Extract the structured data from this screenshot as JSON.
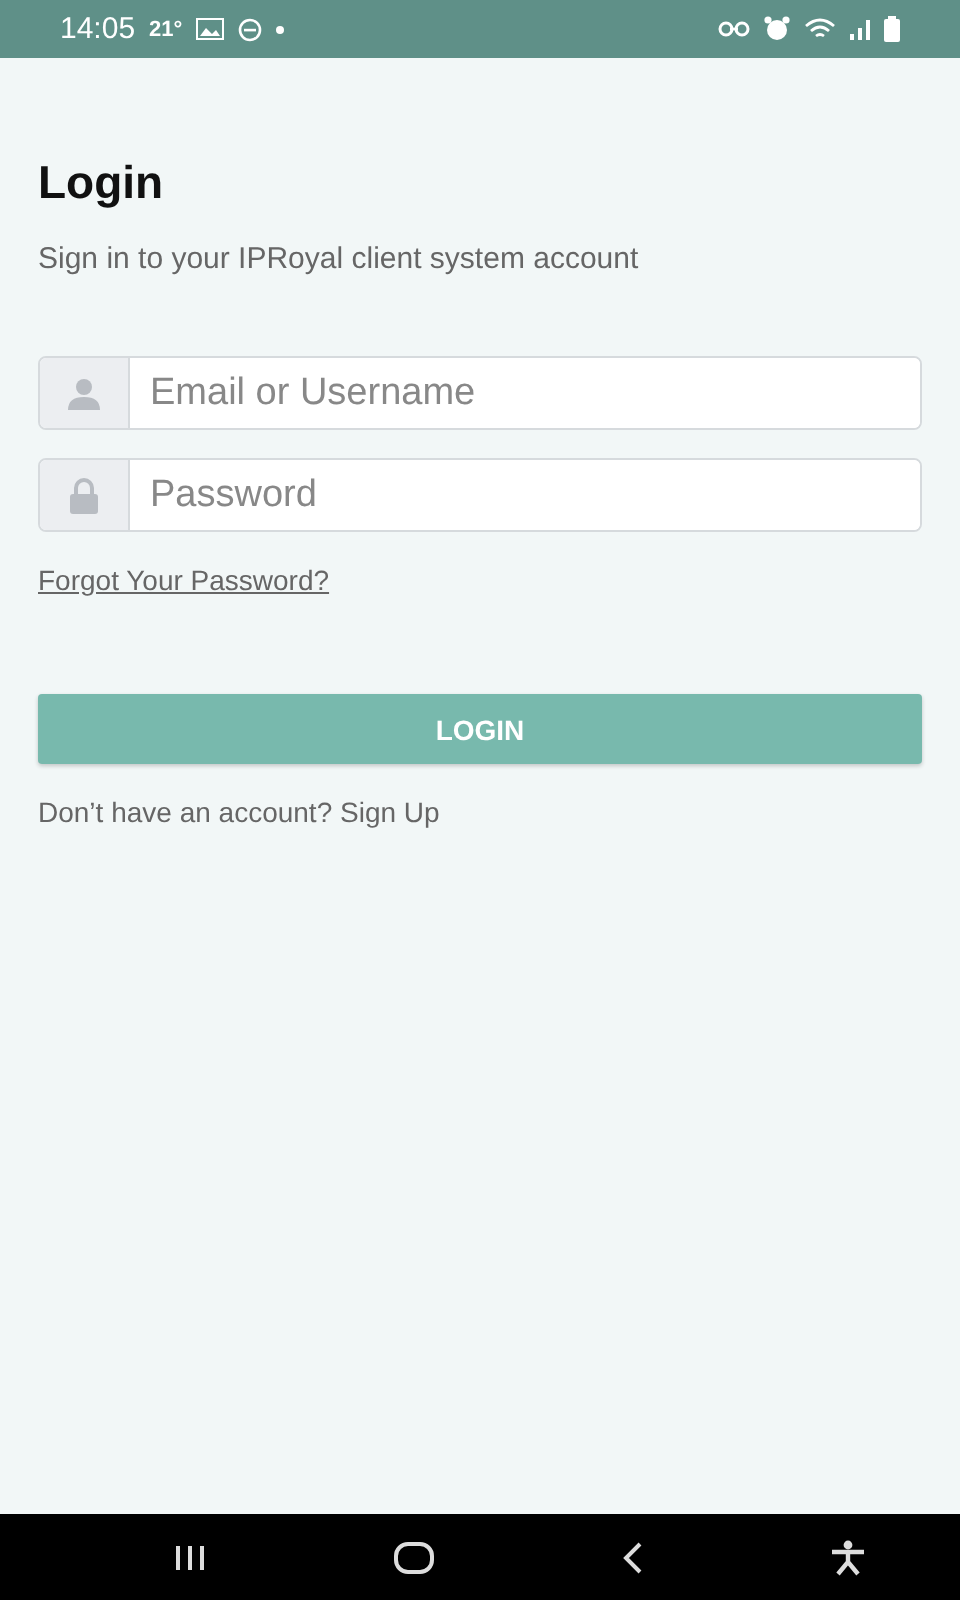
{
  "status_bar": {
    "time": "14:05",
    "temperature": "21°"
  },
  "title": "Login",
  "subtitle": "Sign in to your IPRoyal client system account",
  "fields": [
    {
      "kind": "user",
      "placeholder": "Email or Username"
    },
    {
      "kind": "lock",
      "placeholder": "Password"
    }
  ],
  "forgot_link": "Forgot Your Password?",
  "login_button": "LOGIN",
  "signup_text": "Don’t have an account? Sign Up"
}
